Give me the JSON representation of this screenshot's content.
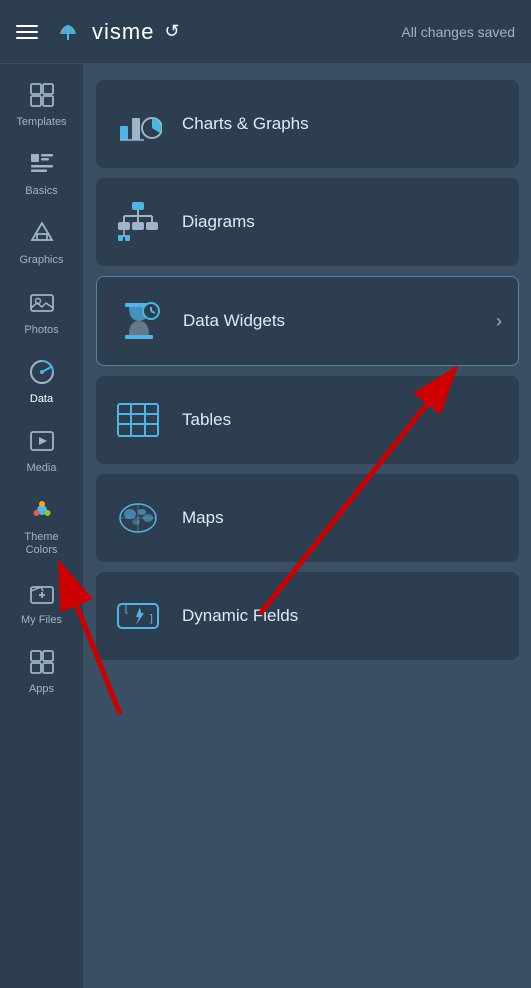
{
  "header": {
    "logo_text": "visme",
    "saved_status": "All changes saved",
    "hamburger_label": "Menu",
    "undo_label": "Undo"
  },
  "sidebar": {
    "items": [
      {
        "id": "templates",
        "label": "Templates",
        "icon": "⊞",
        "active": false
      },
      {
        "id": "basics",
        "label": "Basics",
        "icon": "🔤",
        "active": false
      },
      {
        "id": "graphics",
        "label": "Graphics",
        "icon": "⛰",
        "active": false
      },
      {
        "id": "photos",
        "label": "Photos",
        "icon": "🖼",
        "active": false
      },
      {
        "id": "data",
        "label": "Data",
        "icon": "◑",
        "active": true
      },
      {
        "id": "media",
        "label": "Media",
        "icon": "▶",
        "active": false
      },
      {
        "id": "theme-colors",
        "label": "Theme Colors",
        "icon": "🎨",
        "active": false
      },
      {
        "id": "my-files",
        "label": "My Files",
        "icon": "📁",
        "active": false
      },
      {
        "id": "apps",
        "label": "Apps",
        "icon": "⊞",
        "active": false
      }
    ]
  },
  "content": {
    "menu_items": [
      {
        "id": "charts-graphs",
        "label": "Charts & Graphs",
        "icon_type": "charts"
      },
      {
        "id": "diagrams",
        "label": "Diagrams",
        "icon_type": "diagrams"
      },
      {
        "id": "data-widgets",
        "label": "Data Widgets",
        "icon_type": "data-widgets",
        "active": true,
        "has_chevron": true
      },
      {
        "id": "tables",
        "label": "Tables",
        "icon_type": "tables"
      },
      {
        "id": "maps",
        "label": "Maps",
        "icon_type": "maps"
      },
      {
        "id": "dynamic-fields",
        "label": "Dynamic Fields",
        "icon_type": "dynamic-fields"
      }
    ]
  },
  "colors": {
    "accent": "#4eb5e5",
    "active_bg": "#2d3e50",
    "sidebar_bg": "#2d3e50",
    "panel_bg": "#3a4f63",
    "item_bg": "#2d3e50",
    "text_primary": "#e0eaf4",
    "text_muted": "#a0b4c8"
  }
}
